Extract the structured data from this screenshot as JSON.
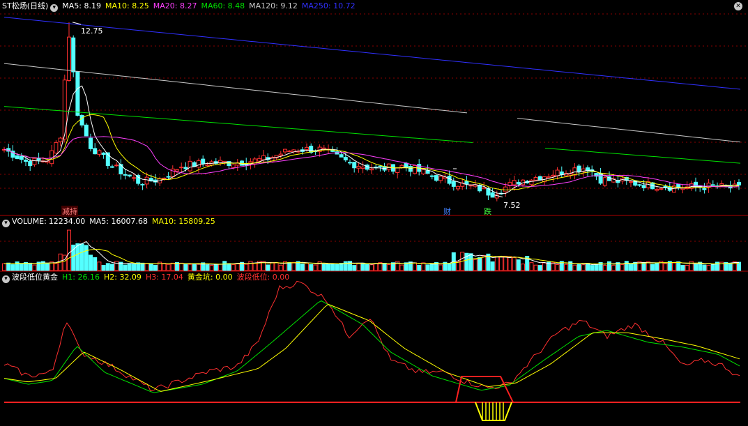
{
  "window": {
    "title": "ST松炀(日线)"
  },
  "price_panel": {
    "ma": [
      {
        "label": "MA5:",
        "value": "8.19",
        "color": "#ffffff"
      },
      {
        "label": "MA10:",
        "value": "8.25",
        "color": "#ffff00"
      },
      {
        "label": "MA20:",
        "value": "8.27",
        "color": "#ff40ff"
      },
      {
        "label": "MA60:",
        "value": "8.48",
        "color": "#00e000"
      },
      {
        "label": "MA120:",
        "value": "9.12",
        "color": "#c8c8c8"
      },
      {
        "label": "MA250:",
        "value": "10.72",
        "color": "#3030ff"
      }
    ],
    "high_label": "12.75",
    "low_label": "7.52",
    "events": [
      "减持",
      "财",
      "跌"
    ]
  },
  "volume_panel": {
    "title": "VOLUME:",
    "value": "12234.00",
    "ma": [
      {
        "label": "MA5:",
        "value": "16007.68",
        "color": "#ffffff"
      },
      {
        "label": "MA10:",
        "value": "15809.25",
        "color": "#ffff00"
      }
    ]
  },
  "indicator_panel": {
    "title": "波段低位黄金",
    "items": [
      {
        "label": "H1:",
        "value": "26.16",
        "color": "#00e000"
      },
      {
        "label": "H2:",
        "value": "32.09",
        "color": "#ffff00"
      },
      {
        "label": "H3:",
        "value": "17.04",
        "color": "#ff3030"
      },
      {
        "label": "黄金坑:",
        "value": "0.00",
        "color": "#ffff00"
      },
      {
        "label": "波段低位:",
        "value": "0.00",
        "color": "#ff3030"
      }
    ]
  },
  "colors": {
    "up": "#ff3030",
    "down": "#54ffff",
    "grid": "#8b0000",
    "separator": "#b00000"
  },
  "chart_data": [
    {
      "type": "candlestick",
      "y_range": [
        7.3,
        13.0
      ],
      "series": [
        {
          "name": "MA5",
          "values": [
            8.19
          ]
        },
        {
          "name": "MA10",
          "values": [
            8.25
          ]
        },
        {
          "name": "MA20",
          "values": [
            8.27
          ]
        },
        {
          "name": "MA60",
          "values": [
            8.48
          ]
        },
        {
          "name": "MA120",
          "values": [
            9.12
          ]
        },
        {
          "name": "MA250",
          "values": [
            10.72
          ]
        }
      ],
      "annotations": [
        {
          "text": "12.75",
          "y": 12.75
        },
        {
          "text": "7.52",
          "y": 7.52
        }
      ]
    },
    {
      "type": "bar",
      "series": [
        {
          "name": "VOLUME",
          "values": [
            12234.0
          ]
        },
        {
          "name": "MA5",
          "values": [
            16007.68
          ]
        },
        {
          "name": "MA10",
          "values": [
            15809.25
          ]
        }
      ]
    },
    {
      "type": "line",
      "series": [
        {
          "name": "H1",
          "values": [
            26.16
          ]
        },
        {
          "name": "H2",
          "values": [
            32.09
          ]
        },
        {
          "name": "H3",
          "values": [
            17.04
          ]
        },
        {
          "name": "黄金坑",
          "values": [
            0.0
          ]
        },
        {
          "name": "波段低位",
          "values": [
            0.0
          ]
        }
      ]
    }
  ]
}
